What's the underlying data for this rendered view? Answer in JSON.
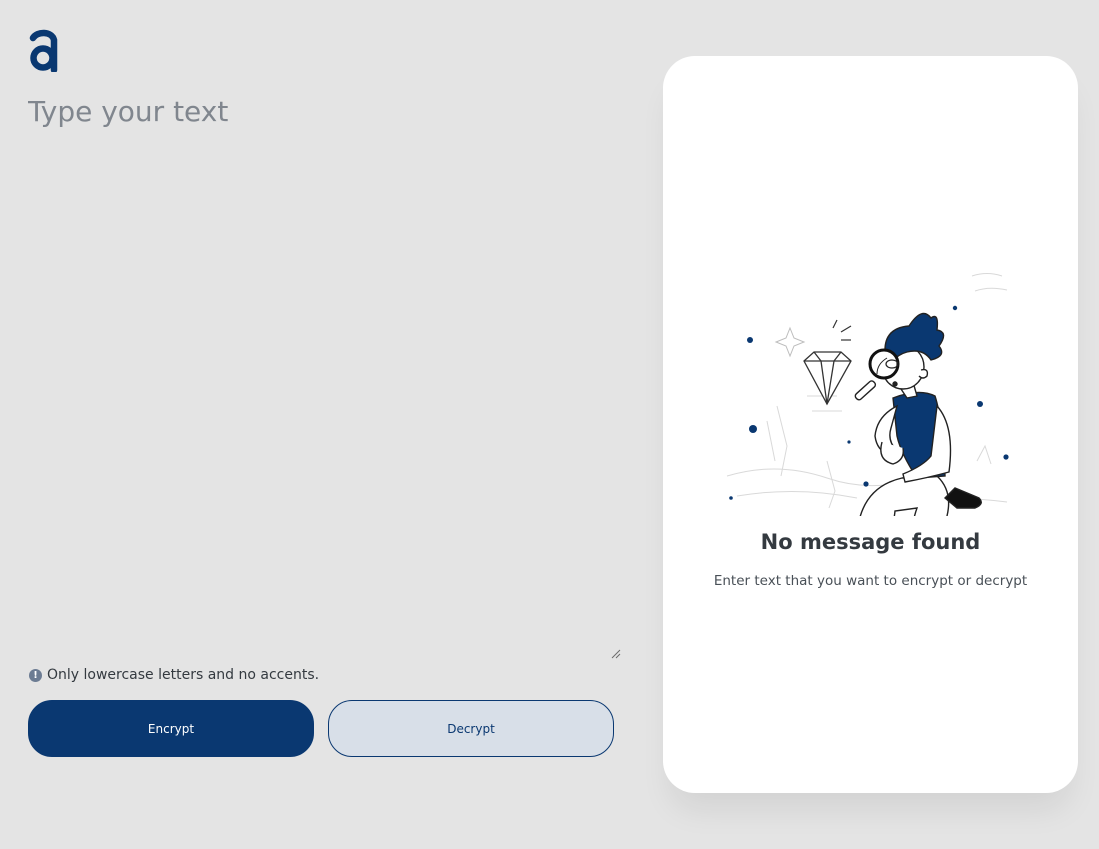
{
  "input": {
    "placeholder": "Type your text",
    "value": ""
  },
  "hint": {
    "icon": "exclamation-circle-icon",
    "text": "Only lowercase letters and no accents."
  },
  "buttons": {
    "encrypt_label": "Encrypt",
    "decrypt_label": "Decrypt"
  },
  "output": {
    "illustration": "person-with-magnifier-illustration",
    "empty_title": "No message found",
    "empty_subtitle": "Enter text that you want to encrypt or decrypt"
  },
  "colors": {
    "background": "#e4e4e4",
    "primary": "#0a3871",
    "secondary_bg": "#d8dfe8",
    "card": "#ffffff"
  }
}
